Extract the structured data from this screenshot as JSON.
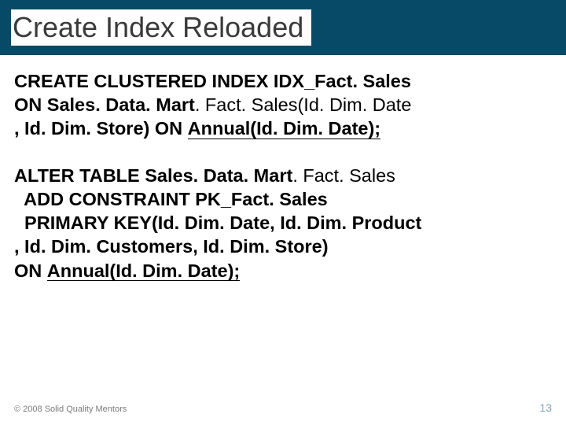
{
  "title": "Create Index Reloaded",
  "sql": {
    "block1_line1": "CREATE  CLUSTERED INDEX IDX_Fact. Sales",
    "block1_line2a": "ON Sales. Data. Mart",
    "block1_line2b": ". Fact. Sales(Id. Dim. Date",
    "block1_line3a": ", Id. Dim. Store) ON ",
    "block1_line3b_ul": "Annual(Id. Dim. Date);",
    "block2_line1": "ALTER TABLE Sales. Data. Mart",
    "block2_line1b": ". Fact. Sales",
    "block2_line2": "  ADD CONSTRAINT PK_Fact. Sales",
    "block2_line3": "  PRIMARY KEY(Id. Dim. Date, Id. Dim. Product",
    "block2_line4": ", Id. Dim. Customers, Id. Dim. Store)",
    "block2_line5a": "ON ",
    "block2_line5b_ul": "Annual(Id. Dim. Date);"
  },
  "footer": {
    "copyright": "© 2008 Solid Quality Mentors",
    "page": "13"
  }
}
